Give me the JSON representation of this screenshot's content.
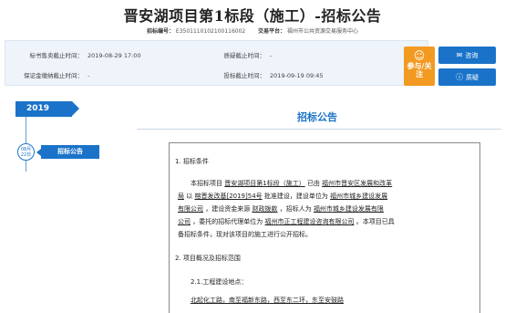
{
  "title": "晋安湖项目第1标段（施工）-招标公告",
  "meta": {
    "code_label": "招标编号：",
    "code_value": "E3501110102100116002",
    "platform_label": "交易平台：",
    "platform_value": "福州市公共资源交易服务中心"
  },
  "info": {
    "sale_deadline_label": "标书售卖截止时间：",
    "sale_deadline_value": "2019-08-29 17:00",
    "question_deadline_label": "质疑截止时间：",
    "question_deadline_value": "-",
    "deposit_deadline_label": "保证金缴纳截止时间：",
    "deposit_deadline_value": "-",
    "bid_deadline_label": "投标截止时间：",
    "bid_deadline_value": "2019-09-19 09:45"
  },
  "actions": {
    "follow_label": "参与/关注",
    "consult_label": "咨询",
    "question_label": "质疑"
  },
  "timeline": {
    "year": "2019",
    "date_month": "08月",
    "date_day": "22日",
    "tab_label": "招标公告"
  },
  "section_title": "招标公告",
  "doc": {
    "h1": "1.  招标条件",
    "p1_l1_a": "本招标项目",
    "p1_l1_project": "晋安湖项目第1标段（施工）",
    "p1_l1_b": "已由",
    "p1_l1_authority": "福州市晋安区发展和改革",
    "p1_l2_authority": "局",
    "p1_l2_a": "以",
    "p1_l2_doc": "榕晋发改基[2019]54号",
    "p1_l2_b": "批准建设，建设单位为",
    "p1_l2_owner": "福州市城乡建设发展",
    "p1_l3_owner": "有限公司",
    "p1_l3_a": "，建设资金来源",
    "p1_l3_fund": "财政拨款",
    "p1_l3_b": "，招标人为",
    "p1_l3_tenderee": "福州市城乡建设发展有限",
    "p1_l4_tenderee": "公司",
    "p1_l4_a": "，委托的招标代理单位为",
    "p1_l4_agent": "福州市正工程建设咨询有限公司",
    "p1_l4_b": "。本项目已具",
    "p1_l5": "备招标条件，现对该项目的施工进行公开招标。",
    "h2": "2.  项目概况及招标范围",
    "s21": "2.1.工程建设地点：",
    "loc": "北起化工路，南至福新东路，西至东二环，东至安鼓路"
  }
}
